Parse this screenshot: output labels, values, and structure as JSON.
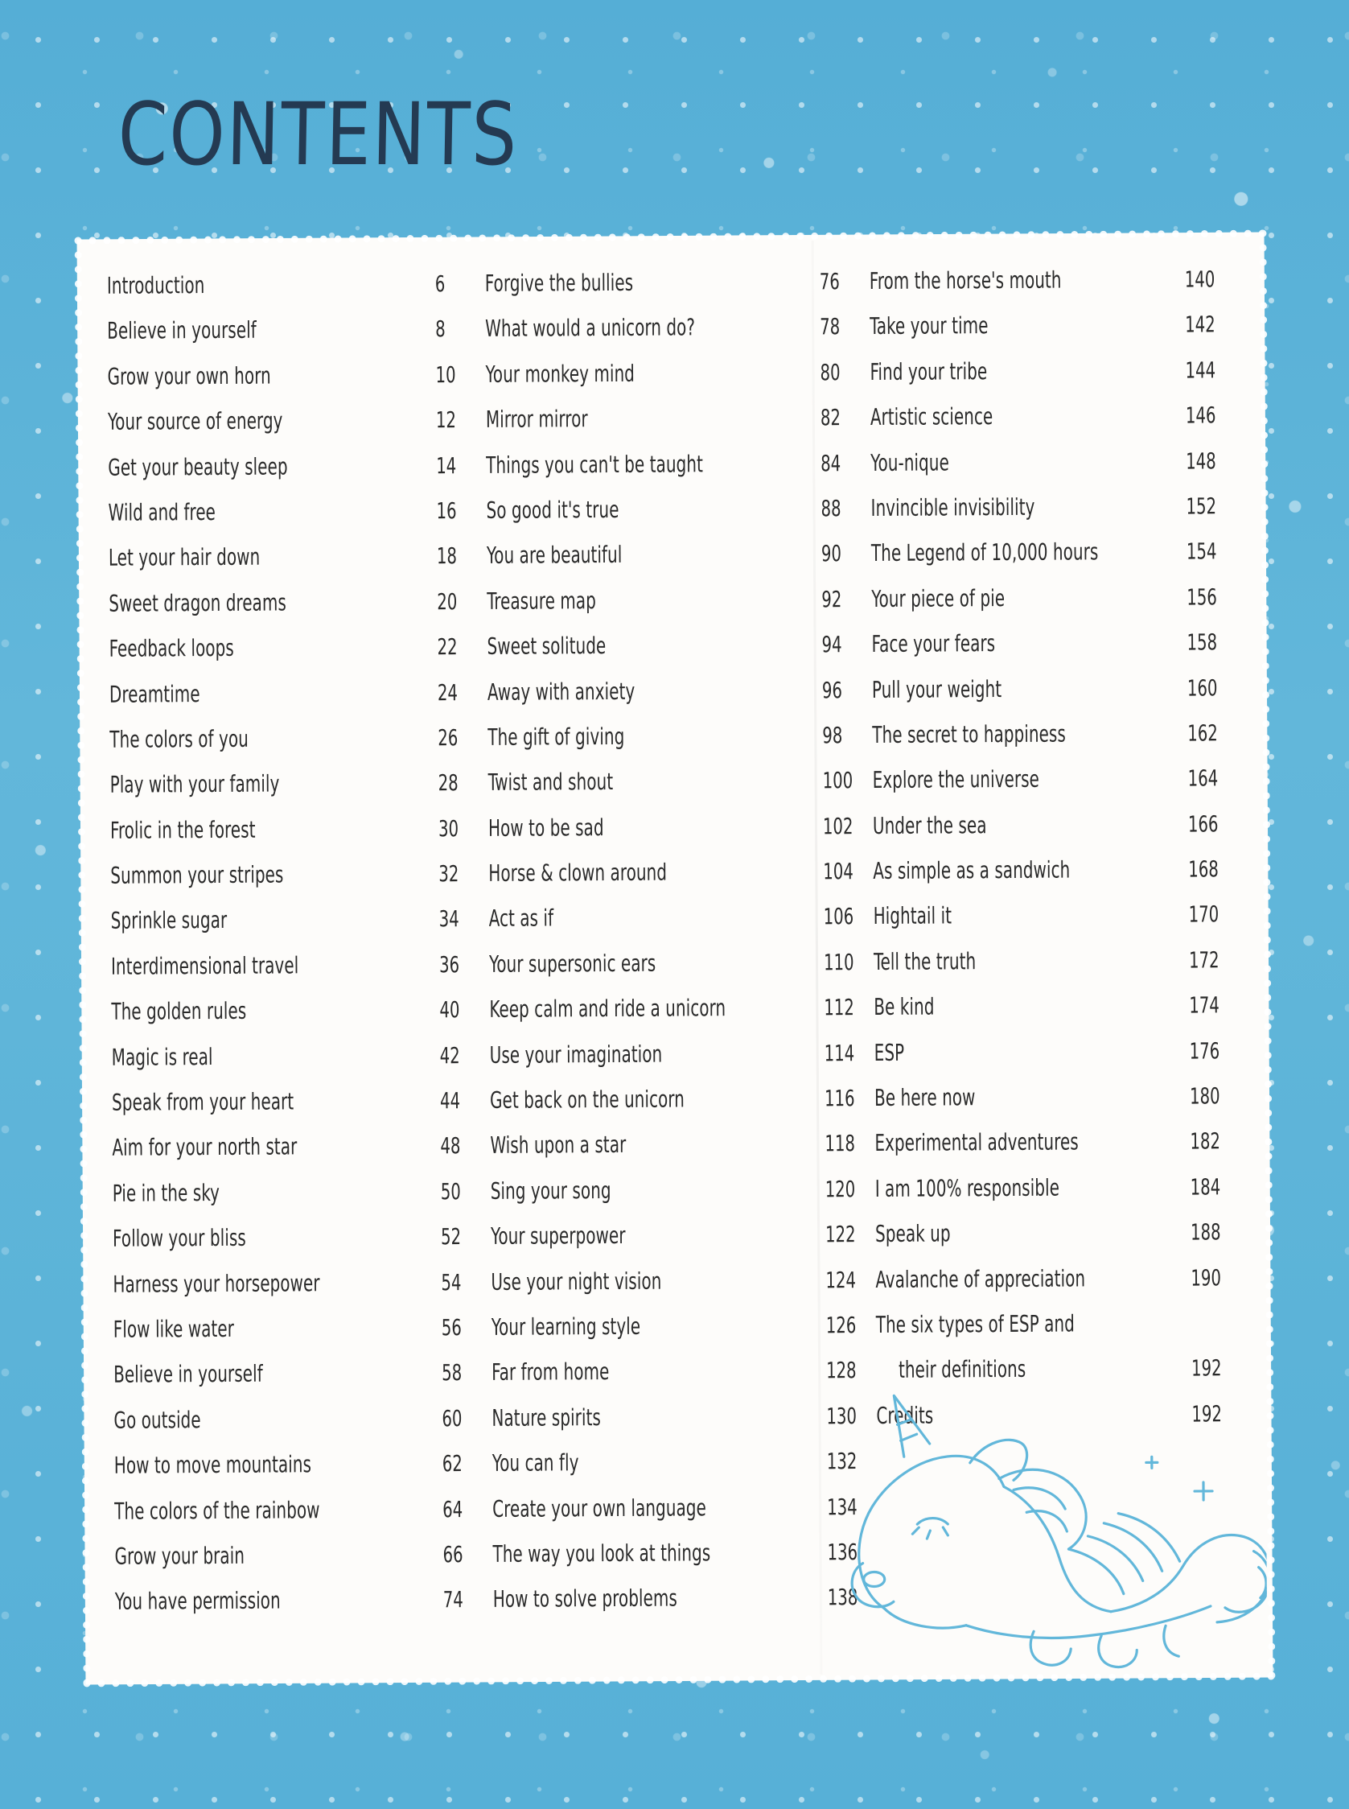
{
  "page": {
    "title": "CONTENTS",
    "accent_color": "#5cb2d7",
    "card_color": "#fdfcfa",
    "text_color": "#2a2a2a",
    "title_color": "#243a52"
  },
  "decor": {
    "unicorn_icon": "sleeping-unicorn-icon",
    "background_icon": "polka-dot-pattern"
  },
  "columns": [
    {
      "id": "column-1",
      "entries": [
        {
          "title": "Introduction",
          "page": "6"
        },
        {
          "title": "Believe in yourself",
          "page": "8"
        },
        {
          "title": "Grow your own horn",
          "page": "10"
        },
        {
          "title": "Your source of energy",
          "page": "12"
        },
        {
          "title": "Get your beauty sleep",
          "page": "14"
        },
        {
          "title": "Wild and free",
          "page": "16"
        },
        {
          "title": "Let your hair down",
          "page": "18"
        },
        {
          "title": "Sweet dragon dreams",
          "page": "20"
        },
        {
          "title": "Feedback loops",
          "page": "22"
        },
        {
          "title": "Dreamtime",
          "page": "24"
        },
        {
          "title": "The colors of you",
          "page": "26"
        },
        {
          "title": "Play with your family",
          "page": "28"
        },
        {
          "title": "Frolic in the forest",
          "page": "30"
        },
        {
          "title": "Summon your stripes",
          "page": "32"
        },
        {
          "title": "Sprinkle sugar",
          "page": "34"
        },
        {
          "title": "Interdimensional travel",
          "page": "36"
        },
        {
          "title": "The golden rules",
          "page": "40"
        },
        {
          "title": "Magic is real",
          "page": "42"
        },
        {
          "title": "Speak from your heart",
          "page": "44"
        },
        {
          "title": "Aim for your north star",
          "page": "48"
        },
        {
          "title": "Pie in the sky",
          "page": "50"
        },
        {
          "title": "Follow your bliss",
          "page": "52"
        },
        {
          "title": "Harness your horsepower",
          "page": "54"
        },
        {
          "title": "Flow like water",
          "page": "56"
        },
        {
          "title": "Believe in yourself",
          "page": "58"
        },
        {
          "title": "Go outside",
          "page": "60"
        },
        {
          "title": "How to move mountains",
          "page": "62"
        },
        {
          "title": "The colors of the rainbow",
          "page": "64"
        },
        {
          "title": "Grow your brain",
          "page": "66"
        },
        {
          "title": "You have permission",
          "page": "74"
        }
      ]
    },
    {
      "id": "column-2",
      "entries": [
        {
          "title": "Forgive the bullies",
          "page": "76"
        },
        {
          "title": "What would a unicorn do?",
          "page": "78"
        },
        {
          "title": "Your monkey mind",
          "page": "80"
        },
        {
          "title": "Mirror mirror",
          "page": "82"
        },
        {
          "title": "Things you can't be taught",
          "page": "84"
        },
        {
          "title": "So good it's true",
          "page": "88"
        },
        {
          "title": "You are beautiful",
          "page": "90"
        },
        {
          "title": "Treasure map",
          "page": "92"
        },
        {
          "title": "Sweet solitude",
          "page": "94"
        },
        {
          "title": "Away with anxiety",
          "page": "96"
        },
        {
          "title": "The gift of giving",
          "page": "98"
        },
        {
          "title": "Twist and shout",
          "page": "100"
        },
        {
          "title": "How to be sad",
          "page": "102"
        },
        {
          "title": "Horse & clown around",
          "page": "104"
        },
        {
          "title": "Act as if",
          "page": "106"
        },
        {
          "title": "Your supersonic ears",
          "page": "110"
        },
        {
          "title": "Keep calm and ride a unicorn",
          "page": "112"
        },
        {
          "title": "Use your imagination",
          "page": "114"
        },
        {
          "title": "Get back on the unicorn",
          "page": "116"
        },
        {
          "title": "Wish upon a star",
          "page": "118"
        },
        {
          "title": "Sing your song",
          "page": "120"
        },
        {
          "title": "Your superpower",
          "page": "122"
        },
        {
          "title": "Use your night vision",
          "page": "124"
        },
        {
          "title": "Your learning style",
          "page": "126"
        },
        {
          "title": "Far from home",
          "page": "128"
        },
        {
          "title": "Nature spirits",
          "page": "130"
        },
        {
          "title": "You can fly",
          "page": "132"
        },
        {
          "title": "Create your own language",
          "page": "134"
        },
        {
          "title": "The way you look at things",
          "page": "136"
        },
        {
          "title": "How to solve problems",
          "page": "138"
        }
      ]
    },
    {
      "id": "column-3",
      "entries": [
        {
          "title": "From the horse's mouth",
          "page": "140"
        },
        {
          "title": "Take your time",
          "page": "142"
        },
        {
          "title": "Find your tribe",
          "page": "144"
        },
        {
          "title": "Artistic science",
          "page": "146"
        },
        {
          "title": "You-nique",
          "page": "148"
        },
        {
          "title": "Invincible invisibility",
          "page": "152"
        },
        {
          "title": "The Legend of 10,000 hours",
          "page": "154"
        },
        {
          "title": "Your piece of pie",
          "page": "156"
        },
        {
          "title": "Face your fears",
          "page": "158"
        },
        {
          "title": "Pull your weight",
          "page": "160"
        },
        {
          "title": "The secret to happiness",
          "page": "162"
        },
        {
          "title": "Explore the universe",
          "page": "164"
        },
        {
          "title": "Under the sea",
          "page": "166"
        },
        {
          "title": "As simple as a sandwich",
          "page": "168"
        },
        {
          "title": "Hightail it",
          "page": "170"
        },
        {
          "title": "Tell the truth",
          "page": "172"
        },
        {
          "title": "Be kind",
          "page": "174"
        },
        {
          "title": "ESP",
          "page": "176"
        },
        {
          "title": "Be here now",
          "page": "180"
        },
        {
          "title": "Experimental adventures",
          "page": "182"
        },
        {
          "title": "I am 100% responsible",
          "page": "184"
        },
        {
          "title": "Speak up",
          "page": "188"
        },
        {
          "title": "Avalanche of appreciation",
          "page": "190"
        },
        {
          "title": "The six types of ESP and",
          "page": "",
          "continued": true
        },
        {
          "title": "their definitions",
          "page": "192",
          "indent": true
        },
        {
          "title": "Credits",
          "page": "192"
        }
      ]
    }
  ]
}
